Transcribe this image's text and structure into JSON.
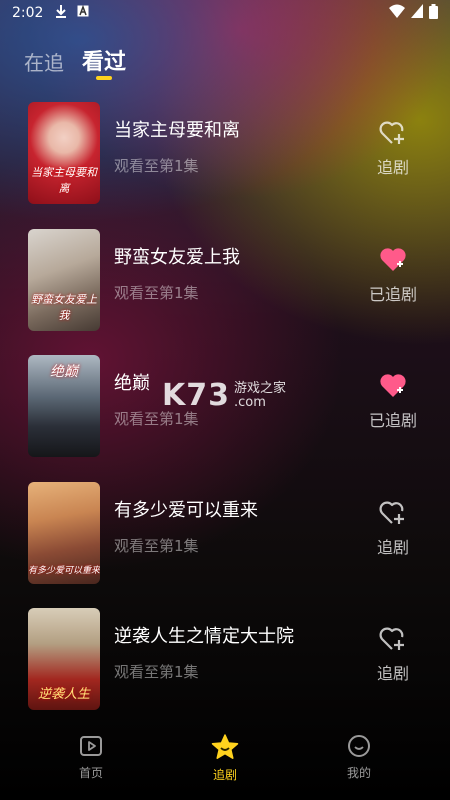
{
  "status_bar": {
    "time": "2:02",
    "icons": [
      "download-icon",
      "a-icon",
      "wifi-icon",
      "signal-icon",
      "battery-icon"
    ]
  },
  "tabs": [
    {
      "label": "在追",
      "active": false
    },
    {
      "label": "看过",
      "active": true
    }
  ],
  "dramas": [
    {
      "title": "当家主母要和离",
      "progress": "观看至第1集",
      "follow_label": "追剧",
      "followed": false,
      "poster_text": "当家主母要和离"
    },
    {
      "title": "野蛮女友爱上我",
      "progress": "观看至第1集",
      "follow_label": "已追剧",
      "followed": true,
      "poster_text": "野蛮女友爱上我"
    },
    {
      "title": "绝巅",
      "progress": "观看至第1集",
      "follow_label": "已追剧",
      "followed": true,
      "poster_text": "绝巅"
    },
    {
      "title": "有多少爱可以重来",
      "progress": "观看至第1集",
      "follow_label": "追剧",
      "followed": false,
      "poster_text": "有多少爱可以重来"
    },
    {
      "title": "逆袭人生之情定大士院",
      "progress": "观看至第1集",
      "follow_label": "追剧",
      "followed": false,
      "poster_text": "逆袭人生"
    }
  ],
  "watermark": {
    "brand": "K73",
    "line1": "游戏之家",
    "line2": ".com"
  },
  "nav": [
    {
      "label": "首页",
      "icon": "play-icon",
      "active": false
    },
    {
      "label": "追剧",
      "icon": "star-icon",
      "active": true
    },
    {
      "label": "我的",
      "icon": "profile-icon",
      "active": false
    }
  ],
  "colors": {
    "accent": "#ffd21e",
    "followed_heart": "#ff5a8a"
  }
}
